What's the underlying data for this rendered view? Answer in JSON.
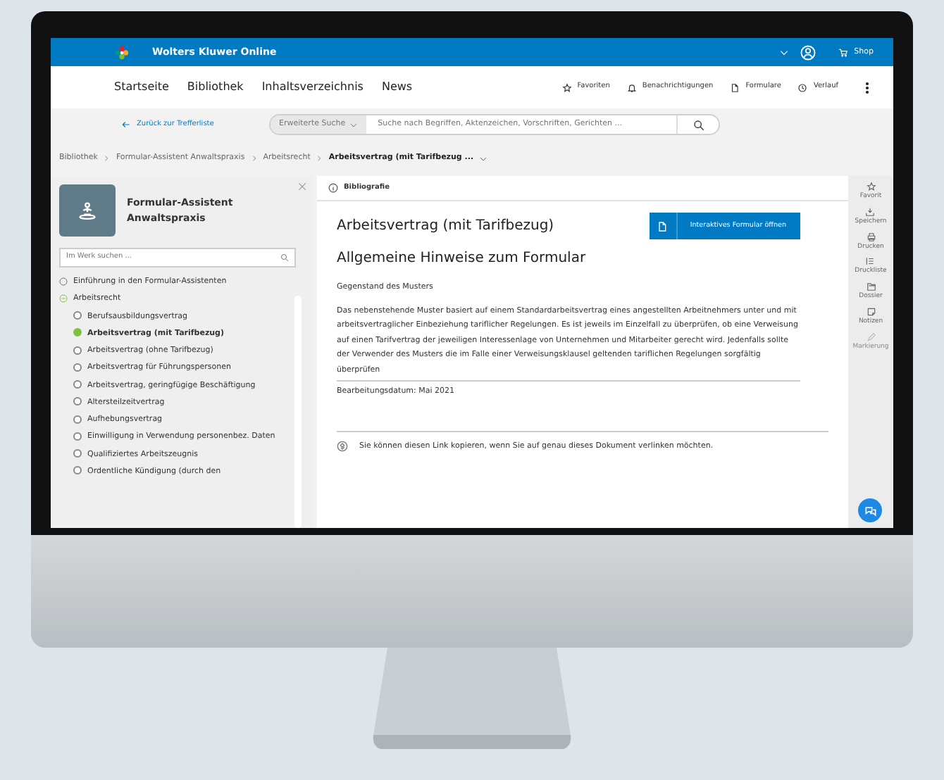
{
  "topbar": {
    "brand": "Wolters Kluwer Online",
    "shop": "Shop"
  },
  "nav": {
    "items": [
      "Startseite",
      "Bibliothek",
      "Inhaltsverzeichnis",
      "News"
    ],
    "actions": [
      {
        "kind": "star",
        "label": "Favoriten"
      },
      {
        "kind": "bell",
        "label": "Benachrichtigungen"
      },
      {
        "kind": "doc",
        "label": "Formulare"
      },
      {
        "kind": "history",
        "label": "Verlauf"
      }
    ]
  },
  "search": {
    "back_link": "Zurück zur Trefferliste",
    "scope": "Erweiterte Suche",
    "placeholder": "Suche nach Begriffen, Aktenzeichen, Vorschriften, Gerichten ..."
  },
  "breadcrumbs": [
    {
      "label": "Bibliothek",
      "current": false
    },
    {
      "label": "Formular-Assistent Anwaltspraxis",
      "current": false
    },
    {
      "label": "Arbeitsrecht",
      "current": false
    },
    {
      "label": "Arbeitsvertrag (mit Tarifbezug ...",
      "current": true
    }
  ],
  "sidebar": {
    "title": "Formular-Assistent Anwaltspraxis",
    "search_placeholder": "Im Werk suchen ...",
    "tree": [
      {
        "label": "Einführung in den Formular-Assistenten",
        "expanded": false,
        "selected": false
      },
      {
        "label": "Arbeitsrecht",
        "expanded": true,
        "selected": false,
        "children": [
          {
            "label": "Berufsausbildungsvertrag",
            "selected": false
          },
          {
            "label": "Arbeitsvertrag (mit Tarifbezug)",
            "selected": true
          },
          {
            "label": "Arbeitsvertrag (ohne Tarifbezug)",
            "selected": false
          },
          {
            "label": "Arbeitsvertrag für Führungspersonen",
            "selected": false
          },
          {
            "label": "Arbeitsvertrag, geringfügige Beschäftigung",
            "selected": false
          },
          {
            "label": "Altersteilzeitvertrag",
            "selected": false
          },
          {
            "label": "Aufhebungsvertrag",
            "selected": false
          },
          {
            "label": "Einwilligung in Verwendung personenbez. Daten",
            "selected": false
          },
          {
            "label": "Qualifiziertes Arbeitszeugnis",
            "selected": false
          },
          {
            "label": "Ordentliche Kündigung (durch den",
            "selected": false
          }
        ]
      }
    ]
  },
  "content": {
    "tab": "Bibliografie",
    "title": "Arbeitsvertrag (mit Tarifbezug)",
    "button": "Interaktives Formular öffnen",
    "heading": "Allgemeine Hinweise zum Formular",
    "subheading": "Gegenstand des Musters",
    "paragraph": "Das nebenstehende Muster basiert auf einem Standardarbeitsvertrag eines angestellten Arbeitnehmers unter und mit arbeitsvertraglicher Einbeziehung tariflicher Regelungen. Es ist jeweils im Einzelfall zu überprüfen, ob eine Verweisung auf einen Tarifvertrag der jeweiligen Interessenlage von Unternehmen und Mitarbeiter gerecht wird. Jedenfalls sollte der Verwender des Musters die im Falle einer Verweisungsklausel geltenden tariflichen Regelungen sorgfältig überprüfen",
    "date": "Bearbeitungsdatum: Mai 2021",
    "link_note": "Sie können diesen Link kopieren, wenn Sie auf genau dieses Dokument verlinken möchten."
  },
  "rail": [
    {
      "kind": "star",
      "label": "Favorit",
      "disabled": false
    },
    {
      "kind": "save",
      "label": "Speichern",
      "disabled": false
    },
    {
      "kind": "print",
      "label": "Drucken",
      "disabled": false
    },
    {
      "kind": "list",
      "label": "Druckliste",
      "disabled": false
    },
    {
      "kind": "folder",
      "label": "Dossier",
      "disabled": false
    },
    {
      "kind": "note",
      "label": "Notizen",
      "disabled": false
    },
    {
      "kind": "pen",
      "label": "Markierung",
      "disabled": true
    }
  ]
}
